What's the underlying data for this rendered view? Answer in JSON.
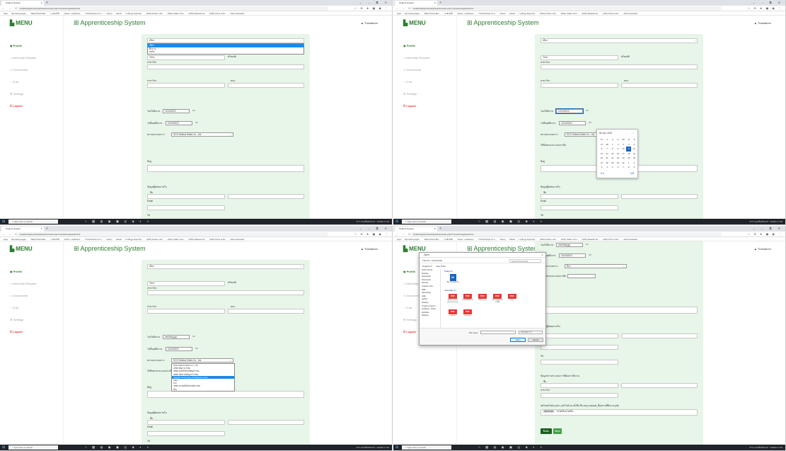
{
  "browser": {
    "tab_title": "Student System",
    "new_tab": "+",
    "window_controls": "⌄ – ⧉ ✕",
    "nav_buttons": "← → C ⌂",
    "url": "localhost/apprenticeship/teacher/index.php?r=student/register&id=12",
    "addr_icons": "☆ ⊕ ★ ▣ ◉ ⋮",
    "bookmarks": [
      "Apps",
      "http://www.google...",
      "Watch Drama Bar...",
      "รวมลิงก์ที่ดี...",
      "Netnet - usefulness...",
      "TN Photoshop CC a...",
      "Udemy",
      "GitHub",
      "รวมข้อมูล SuperTop...",
      "(DVD) Anthem v.Ro...",
      "(DVD) Golden Time...",
      "(DVD) Salaeinfo de...",
      "(DVD) Prince of En...",
      "Other bookmarks"
    ]
  },
  "sidebar": {
    "brand": "MENU",
    "items": [
      "Profile",
      "Internship Request",
      "Documents",
      "Chat",
      "Settings",
      "Logout"
    ]
  },
  "header": {
    "title": "Apprenticeship System",
    "user": "Thanakorn"
  },
  "form": {
    "select_placeholder": "เลือก",
    "select_options": [
      "เลือก",
      "ฝึกงาน",
      "สหกิจ"
    ],
    "label_name": "ชื่อ",
    "name_value": "วิชชา",
    "surname_value": "ศรีสมบัติ",
    "label_faculty": "สาขาวิชา",
    "label_program": "สาขาวิชา",
    "label_faculty_right": "คณะ",
    "label_start": "วันเริ่มฝึกงาน",
    "start_date": "11/04/2022",
    "start_date_empty": "mm/dd/yyyy",
    "label_end": "วันสิ้นสุดฝึกงาน",
    "end_date": "11/04/2022",
    "label_company": "สถานประกอบการ",
    "company_value": "SCG-Sekisui Sales Co., Ltd.",
    "company_value_alt": "อื่นๆ",
    "label_other_company": "ใส่ชื่อสถานประกอบการอื่น",
    "company_options": [
      "SCG-Sekisui Sales Co., Ltd.",
      "บริษัท ปัตตาล จำกัด",
      "บริษัท ฝ่ายั้งรีไซโอริชั่นยี่ จำกัด",
      "บริษัท เอ็กซ์ เซลล์ลูลาร์ จำกัด",
      "Seagate Technology (Thailand) Limited",
      "Sahe",
      "123",
      "บริษัท ดาเซอร์ดย์โตเชต์ดี จำกัด",
      "อื่นๆ"
    ],
    "label_address": "ที่อยู่",
    "label_contact": "ข้อมูลผู้ติดต่อภายใน",
    "contact_name": "ชื่อ",
    "contact_position": "ตำแหน่ง",
    "label_email": "Email",
    "label_tel": "Tel",
    "label_contact2": "ข้อมูลสถานประกอบการที่ต้องการฝึกงาน",
    "upload_note": "อัพโหลดไฟล์ (เฉพาะ pdf ไฟล์ และตั้งชื่อ ชื่อ-สกุล_request_ชื่อสถานที่ฝึกงาน.pdf)",
    "choose_file": "เลือกไฟล์",
    "no_file": "ไม่ได้เลือกไฟล์ใด",
    "submit": "ยืนยันข้อมูล",
    "save": "Save"
  },
  "datepicker": {
    "month": "มีนาคม 2022",
    "weekdays": [
      "อา",
      "จ",
      "อ",
      "พ",
      "พฤ",
      "ศ",
      "ส"
    ],
    "weeks": [
      [
        "27",
        "28",
        "1",
        "2",
        "3",
        "4",
        "5"
      ],
      [
        "6",
        "7",
        "8",
        "9",
        "10",
        "11",
        "12"
      ],
      [
        "13",
        "14",
        "15",
        "16",
        "17",
        "18",
        "19"
      ],
      [
        "20",
        "21",
        "22",
        "23",
        "24",
        "25",
        "26"
      ],
      [
        "27",
        "28",
        "29",
        "30",
        "31",
        "1",
        "2"
      ],
      [
        "3",
        "4",
        "5",
        "6",
        "7",
        "8",
        "9"
      ]
    ],
    "selected": "11",
    "clear": "ล้าง",
    "today": "วันนี้"
  },
  "file_dialog": {
    "title": "Open",
    "path": "This PC › Downloads",
    "search": "Search Downloads",
    "organize": "Organize ▾",
    "new_folder": "New folder",
    "nav": [
      "Quick access",
      "Desktop",
      "Downloads",
      "Documents",
      "Pictures",
      "Creative Clou...",
      "2566",
      "Advertising",
      "caller",
      "ผลสัมฤ",
      "Desktop",
      "Creative Cloud F",
      "OneDrive - Perso",
      "AppData",
      "Desktop"
    ],
    "group_today": "Today (1)",
    "group_yesterday": "Yesterday (7)",
    "files_today": [
      "ฝึกงานแบบฟอร์ม"
    ],
    "files_yesterday": [
      "Adobe acrobat paid license key",
      "แบบฟอร์มฝึกงาน",
      "Skill set-up",
      "เอกสารขอความร่วมมือ",
      "flow",
      "resume",
      "transcript"
    ],
    "filename_label": "File name:",
    "filetype": "Text Files (*.*)",
    "open": "Open",
    "cancel": "Cancel"
  },
  "taskbar": {
    "search": "Type here to search",
    "tray": "27°C เมฆเป็นส่วนมาก  ^ ⊕ ENG  17:04"
  },
  "colors": {
    "brand": "#2e7d32",
    "content_bg": "#e8f5e9",
    "logout": "#e53935"
  }
}
